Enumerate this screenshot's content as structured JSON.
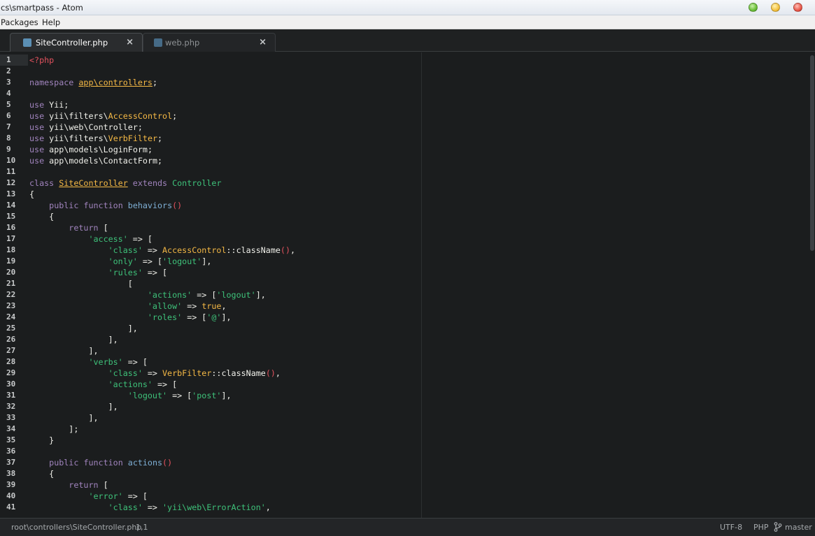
{
  "window": {
    "title": "cs\\smartpass - Atom"
  },
  "menubar": {
    "items": [
      "Packages",
      "Help"
    ]
  },
  "tabs": [
    {
      "label": "SiteController.php",
      "active": true
    },
    {
      "label": "web.php",
      "active": false
    }
  ],
  "editor": {
    "line_numbers": [
      "1",
      "2",
      "3",
      "4",
      "5",
      "6",
      "7",
      "8",
      "9",
      "10",
      "11",
      "12",
      "13",
      "14",
      "15",
      "16",
      "17",
      "18",
      "19",
      "20",
      "21",
      "22",
      "23",
      "24",
      "25",
      "26",
      "27",
      "28",
      "29",
      "30",
      "31",
      "32",
      "33",
      "34",
      "35",
      "36",
      "37",
      "38",
      "39",
      "40",
      "41"
    ],
    "lines": [
      "<?php",
      "",
      "namespace app\\controllers;",
      "",
      "use Yii;",
      "use yii\\filters\\AccessControl;",
      "use yii\\web\\Controller;",
      "use yii\\filters\\VerbFilter;",
      "use app\\models\\LoginForm;",
      "use app\\models\\ContactForm;",
      "",
      "class SiteController extends Controller",
      "{",
      "    public function behaviors()",
      "    {",
      "        return [",
      "            'access' => [",
      "                'class' => AccessControl::className(),",
      "                'only' => ['logout'],",
      "                'rules' => [",
      "                    [",
      "                        'actions' => ['logout'],",
      "                        'allow' => true,",
      "                        'roles' => ['@'],",
      "                    ],",
      "                ],",
      "            ],",
      "            'verbs' => [",
      "                'class' => VerbFilter::className(),",
      "                'actions' => [",
      "                    'logout' => ['post'],",
      "                ],",
      "            ],",
      "        ];",
      "    }",
      "",
      "    public function actions()",
      "    {",
      "        return [",
      "            'error' => [",
      "                'class' => 'yii\\web\\ErrorAction',"
    ]
  },
  "statusbar": {
    "path": "root\\controllers\\SiteController.php",
    "cursor": "1,1",
    "encoding": "UTF-8",
    "grammar": "PHP",
    "branch": "master"
  },
  "colors": {
    "background": "#1b1d1e",
    "keyword": "#a184be",
    "string": "#3ec27a",
    "class": "#f5b945",
    "tag": "#e3525e"
  },
  "icons": {
    "tab_file": "php-file-icon",
    "tab_close": "close-icon",
    "branch": "git-branch-icon"
  }
}
